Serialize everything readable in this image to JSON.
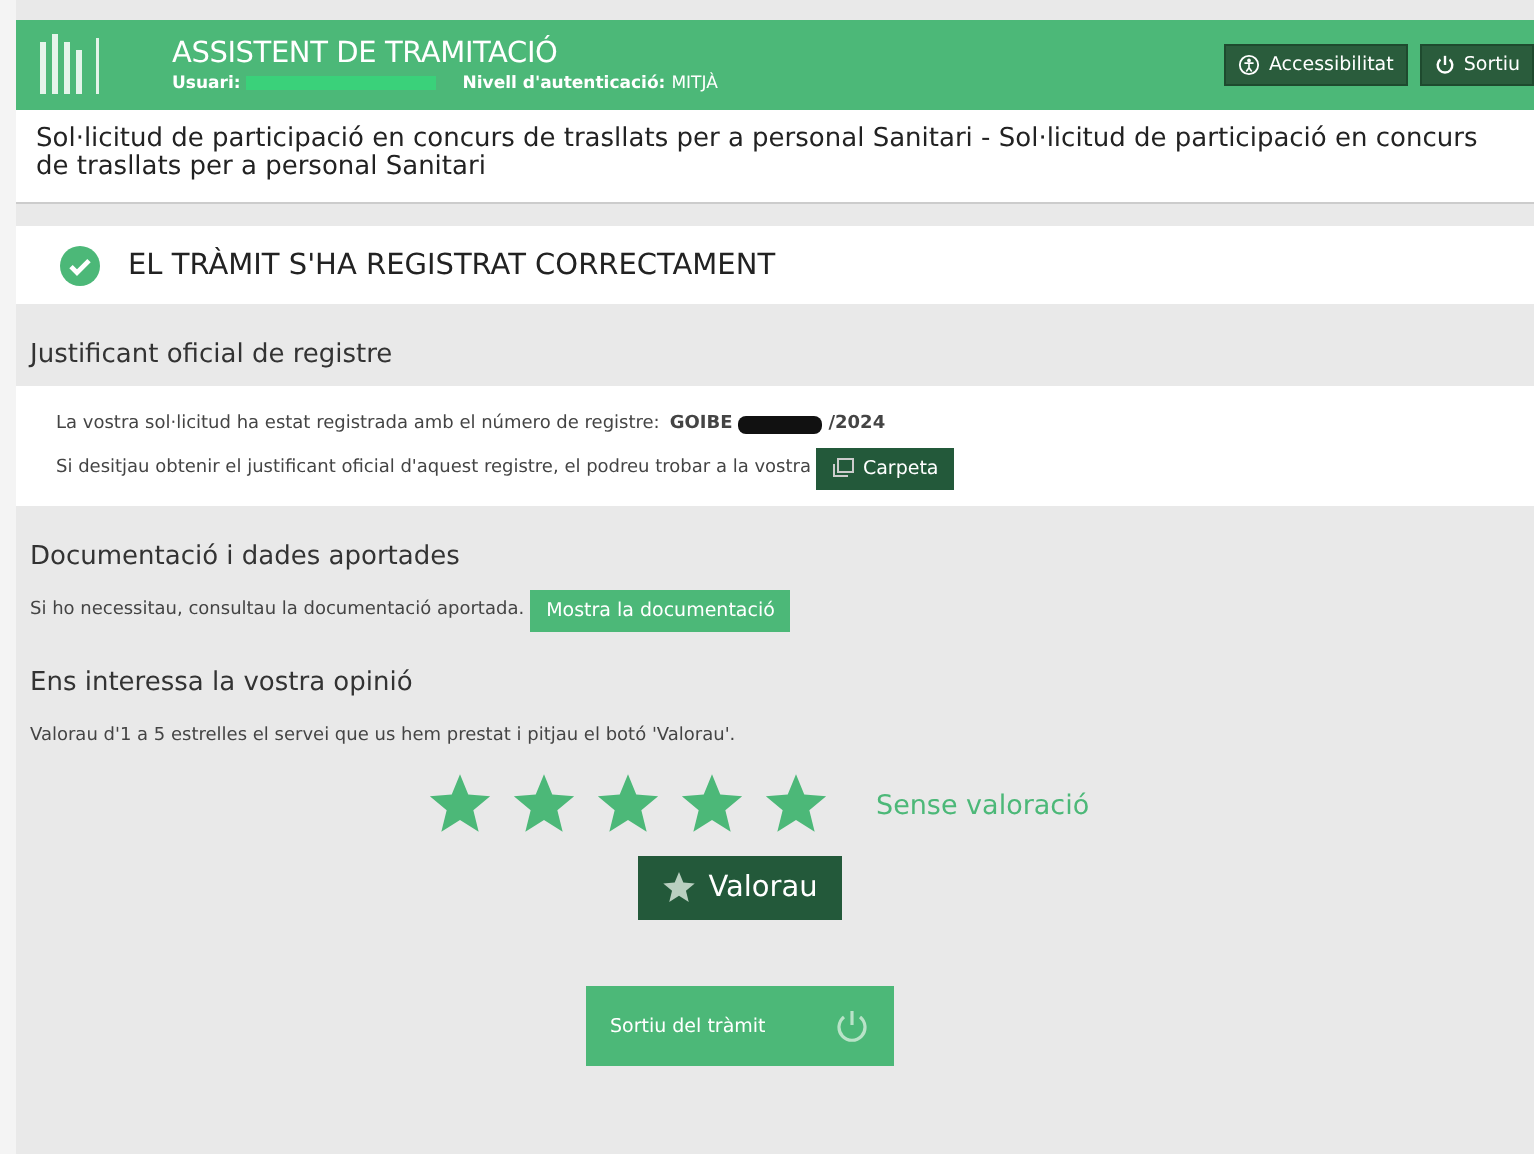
{
  "header": {
    "title": "ASSISTENT DE TRAMITACIÓ",
    "user_label": "Usuari:",
    "auth_label": "Nivell d'autenticació:",
    "auth_value": "MITJÀ",
    "buttons": [
      "Accessibilitat",
      "Sortiu"
    ]
  },
  "procedure_title": "Sol·licitud de participació en concurs de trasllats per a personal Sanitari - Sol·licitud de participació en concurs de trasllats per a personal Sanitari",
  "success_message": "EL TRÀMIT S'HA REGISTRAT CORRECTAMENT",
  "receipt": {
    "heading": "Justificant oficial de registre",
    "registered_text": "La vostra sol·licitud ha estat registrada amb el número de registre:",
    "number_prefix": "GOIBE",
    "number_suffix": "/2024",
    "folder_text": "Si desitjau obtenir el justificant oficial d'aquest registre, el podreu trobar a la vostra",
    "folder_button": "Carpeta"
  },
  "documentation": {
    "heading": "Documentació i dades aportades",
    "text": "Si ho necessitau, consultau la documentació aportada.",
    "button": "Mostra la documentació"
  },
  "opinion": {
    "heading": "Ens interessa la vostra opinió",
    "text": "Valorau d'1 a 5 estrelles el servei que us hem prestat i pitjau el botó 'Valorau'.",
    "stars": 5,
    "rating_label": "Sense valoració",
    "button": "Valorau"
  },
  "exit_button": "Sortiu del tràmit"
}
